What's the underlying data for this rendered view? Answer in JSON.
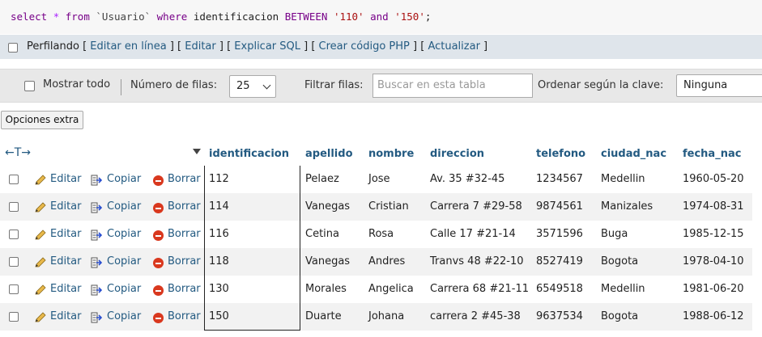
{
  "sql": {
    "kw_select": "select",
    "star": "*",
    "kw_from": "from",
    "table": "`Usuario`",
    "kw_where": "where",
    "column": "identificacion",
    "kw_between": "BETWEEN",
    "low": "'110'",
    "kw_and": "and",
    "high": "'150'",
    "end": ";"
  },
  "profile_bar": {
    "label": "Perfilando",
    "open1": " [ ",
    "edit_inline": "Editar en línea",
    "sep1": " ] [ ",
    "edit": "Editar",
    "sep2": " ] [ ",
    "explain": "Explicar SQL",
    "sep3": " ] [ ",
    "create_php": "Crear código PHP",
    "sep4": " ] [ ",
    "refresh": "Actualizar",
    "close": " ]"
  },
  "nav": {
    "show_all": "Mostrar todo",
    "rows_label": "Número de filas:",
    "rows_value": "25",
    "filter_label": "Filtrar filas:",
    "filter_placeholder": "Buscar en esta tabla",
    "sort_label": "Ordenar según la clave:",
    "sort_value": "Ninguna"
  },
  "extra_options": "Opciones extra",
  "table": {
    "arrows": "←T→",
    "columns": [
      "identificacion",
      "apellido",
      "nombre",
      "direccion",
      "telefono",
      "ciudad_nac",
      "fecha_nac"
    ],
    "actions": {
      "edit": "Editar",
      "copy": "Copiar",
      "delete": "Borrar"
    },
    "rows": [
      [
        "112",
        "Pelaez",
        "Jose",
        "Av. 35 #32-45",
        "1234567",
        "Medellin",
        "1960-05-20"
      ],
      [
        "114",
        "Vanegas",
        "Cristian",
        "Carrera 7 #29-58",
        "9874561",
        "Manizales",
        "1974-08-31"
      ],
      [
        "116",
        "Cetina",
        "Rosa",
        "Calle 17 #21-14",
        "3571596",
        "Buga",
        "1985-12-15"
      ],
      [
        "118",
        "Vanegas",
        "Andres",
        "Tranvs 48 #22-10",
        "8527419",
        "Bogota",
        "1978-04-10"
      ],
      [
        "130",
        "Morales",
        "Angelica",
        "Carrera 68 #21-11",
        "6549518",
        "Medellin",
        "1981-06-20"
      ],
      [
        "150",
        "Duarte",
        "Johana",
        "carrera 2 #45-38",
        "9637534",
        "Bogota",
        "1988-06-12"
      ]
    ]
  }
}
